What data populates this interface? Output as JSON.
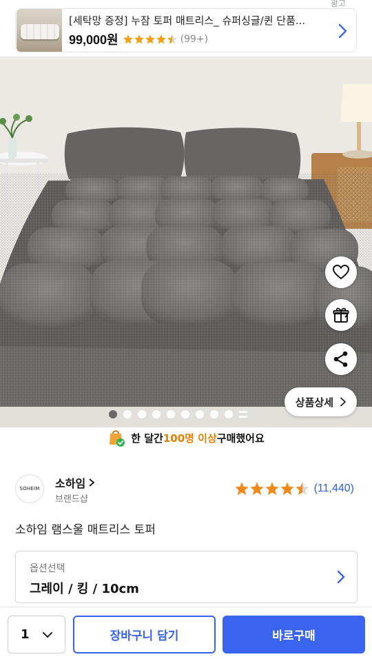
{
  "ad": {
    "label": "광고",
    "title": "[세탁망 증정] 누잠 토퍼 매트리스_ 슈퍼싱글/퀸 단품...",
    "price": "99,000원",
    "rating_stars": 4.5,
    "review_count": "(99+)"
  },
  "gallery": {
    "total_images": 10,
    "current_image": 1,
    "detail_button": "상품상세"
  },
  "notice": {
    "prefix": "한 달간 ",
    "highlight": "100명 이상",
    "suffix": " 구매했어요"
  },
  "brand": {
    "logo_text": "SOHEIM",
    "name": "소하임",
    "sub": "브랜드샵",
    "rating_stars": 4.5,
    "review_count": "(11,440)"
  },
  "product": {
    "title": "소하임 램스울 매트리스 토퍼"
  },
  "option": {
    "label": "옵션선택",
    "value": "그레이 / 킹 / 10cm"
  },
  "bottom": {
    "quantity": "1",
    "cart_label": "장바구니 담기",
    "buy_label": "바로구매"
  },
  "colors": {
    "accent_blue": "#3a63ee",
    "star_orange": "#f08a1c",
    "highlight_orange": "#e67e00",
    "link_blue": "#2e5ed7"
  }
}
